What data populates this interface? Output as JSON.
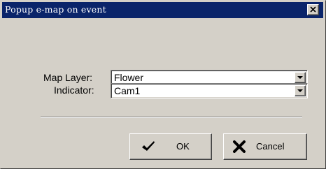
{
  "window": {
    "title": "Popup e-map on event"
  },
  "icons": {
    "close": "close-icon",
    "dropdown": "chevron-down-icon",
    "ok": "checkmark-icon",
    "cancel": "x-mark-icon"
  },
  "form": {
    "map_layer": {
      "label": "Map Layer:",
      "value": "Flower"
    },
    "indicator": {
      "label": "Indicator:",
      "value": "Cam1"
    }
  },
  "buttons": {
    "ok_label": "OK",
    "cancel_label": "Cancel"
  },
  "colors": {
    "titlebar": "#0a246a",
    "face": "#d4d0c8"
  }
}
